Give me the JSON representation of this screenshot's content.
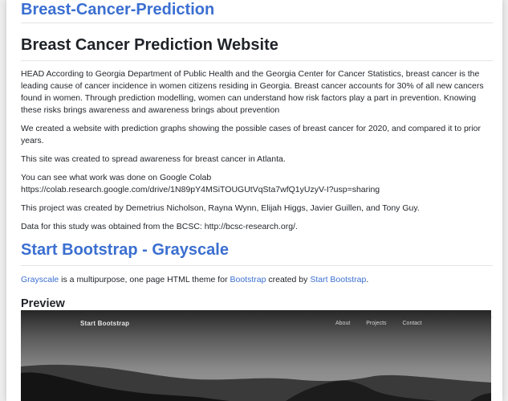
{
  "repo_title": "Breast-Cancer-Prediction",
  "site_title": "Breast Cancer Prediction Website",
  "paragraphs": [
    "HEAD According to Georgia Department of Public Health and the Georgia Center for Cancer Statistics, breast cancer is the leading cause of cancer incidence in women citizens residing in Georgia. Breast cancer accounts for 30% of all new cancers found in women. Through prediction modelling, women can understand how risk factors play a part in prevention. Knowing these risks brings awareness and awareness brings about prevention",
    "We created a website with prediction graphs showing the possible cases of breast cancer for 2020, and compared it to prior years.",
    "This site was created to spread awareness for breast cancer in Atlanta.",
    "You can see what work was done on Google Colab https://colab.research.google.com/drive/1N89pY4MSiTOUGUtVqSta7wfQ1yUzyV-I?usp=sharing",
    "This project was created by Demetrius Nicholson, Rayna Wynn, Elijah Higgs, Javier Guillen, and Tony Guy.",
    "Data for this study was obtained from the BCSC: http://bcsc-research.org/."
  ],
  "section_title": "Start Bootstrap - Grayscale",
  "grayscale_line": {
    "link1": "Grayscale",
    "text1": " is a multipurpose, one page HTML theme for ",
    "link2": "Bootstrap",
    "text2": " created by ",
    "link3": "Start Bootstrap",
    "text3": "."
  },
  "preview_title": "Preview",
  "preview": {
    "brand": "Start Bootstrap",
    "nav": [
      "About",
      "Projects",
      "Contact"
    ]
  },
  "colors": {
    "link": "#3b6fd1",
    "text": "#1f2328"
  }
}
